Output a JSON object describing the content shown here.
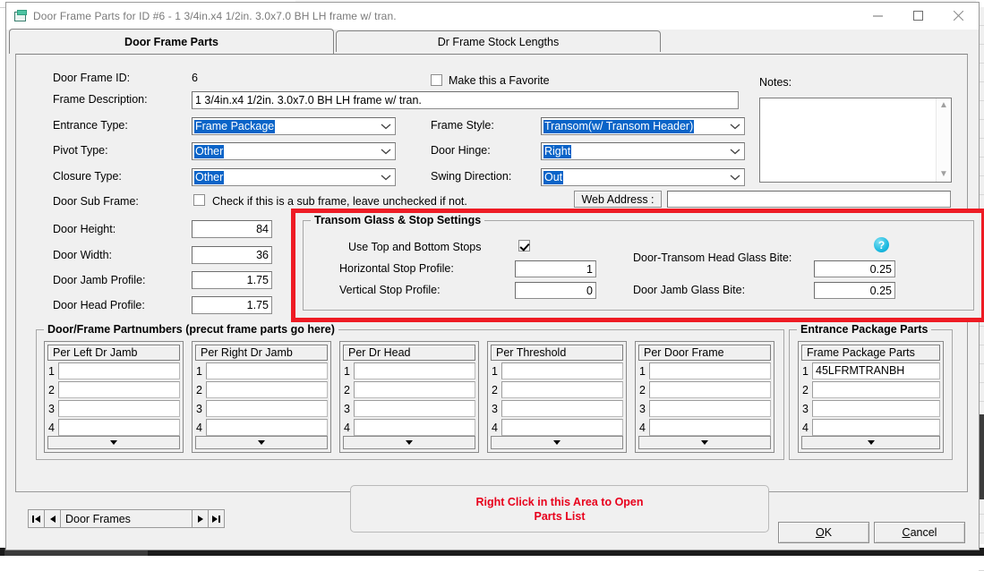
{
  "window": {
    "title": "Door Frame Parts for ID #6 - 1 3/4in.x4 1/2in. 3.0x7.0 BH LH frame w/ tran.",
    "icon": "window-app-icon",
    "minimize_label": "Minimize",
    "maximize_label": "Maximize",
    "close_label": "Close"
  },
  "tabs": [
    {
      "label": "Door Frame Parts",
      "active": true
    },
    {
      "label": "Dr Frame Stock Lengths",
      "active": false
    }
  ],
  "form": {
    "door_frame_id_label": "Door Frame ID:",
    "door_frame_id_value": "6",
    "frame_description_label": "Frame Description:",
    "frame_description_value": "1 3/4in.x4 1/2in. 3.0x7.0 BH LH frame w/ tran.",
    "entrance_type_label": "Entrance Type:",
    "entrance_type_value": "Frame Package",
    "pivot_type_label": "Pivot Type:",
    "pivot_type_value": "Other",
    "closure_type_label": "Closure Type:",
    "closure_type_value": "Other",
    "door_sub_frame_label": "Door Sub Frame:",
    "door_sub_frame_checkbox_text": "Check if this is a sub frame, leave unchecked if not.",
    "door_sub_frame_checked": false,
    "door_height_label": "Door Height:",
    "door_height_value": "84",
    "door_width_label": "Door Width:",
    "door_width_value": "36",
    "door_jamb_profile_label": "Door Jamb Profile:",
    "door_jamb_profile_value": "1.75",
    "door_head_profile_label": "Door Head Profile:",
    "door_head_profile_value": "1.75",
    "make_favorite_label": "Make this a Favorite",
    "make_favorite_checked": false,
    "frame_style_label": "Frame Style:",
    "frame_style_value": "Transom(w/ Transom Header)",
    "door_hinge_label": "Door Hinge:",
    "door_hinge_value": "Right",
    "swing_direction_label": "Swing Direction:",
    "swing_direction_value": "Out",
    "web_address_label": "Web Address :",
    "web_address_value": "",
    "notes_label": "Notes:",
    "notes_value": ""
  },
  "transom_group": {
    "title": "Transom Glass & Stop Settings",
    "use_top_bottom_stops_label": "Use Top and Bottom Stops",
    "use_top_bottom_stops_checked": true,
    "horizontal_stop_profile_label": "Horizontal Stop Profile:",
    "horizontal_stop_profile_value": "1",
    "vertical_stop_profile_label": "Vertical Stop Profile:",
    "vertical_stop_profile_value": "0",
    "door_transom_head_glass_bite_label": "Door-Transom Head Glass Bite:",
    "door_transom_head_glass_bite_value": "0.25",
    "door_jamb_glass_bite_label": "Door Jamb Glass Bite:",
    "door_jamb_glass_bite_value": "0.25",
    "help_icon": "question-mark-icon",
    "highlight_color": "#ee1b24"
  },
  "partnumbers_group": {
    "title": "Door/Frame Partnumbers (precut frame parts go here)",
    "lists": [
      {
        "header": "Per Left Dr Jamb",
        "rows": [
          "1",
          "2",
          "3",
          "4"
        ],
        "values": [
          "",
          "",
          "",
          ""
        ]
      },
      {
        "header": "Per Right Dr Jamb",
        "rows": [
          "1",
          "2",
          "3",
          "4"
        ],
        "values": [
          "",
          "",
          "",
          ""
        ]
      },
      {
        "header": "Per Dr Head",
        "rows": [
          "1",
          "2",
          "3",
          "4"
        ],
        "values": [
          "",
          "",
          "",
          ""
        ]
      },
      {
        "header": "Per Threshold",
        "rows": [
          "1",
          "2",
          "3",
          "4"
        ],
        "values": [
          "",
          "",
          "",
          ""
        ]
      },
      {
        "header": "Per Door Frame",
        "rows": [
          "1",
          "2",
          "3",
          "4"
        ],
        "values": [
          "",
          "",
          "",
          ""
        ]
      }
    ]
  },
  "entrance_package_group": {
    "title": "Entrance Package Parts",
    "lists": [
      {
        "header": "Frame Package Parts",
        "rows": [
          "1",
          "2",
          "3",
          "4"
        ],
        "values": [
          "45LFRMTRANBH",
          "",
          "",
          ""
        ]
      }
    ]
  },
  "navigator": {
    "first_label": "First record",
    "prev_label": "Previous record",
    "text": "Door Frames",
    "next_label": "Next record",
    "last_label": "Last record"
  },
  "right_click_area": {
    "line1": "Right Click in this Area to Open",
    "line2": "Parts List",
    "color": "#e8001c"
  },
  "buttons": {
    "ok": "OK",
    "ok_accel": "O",
    "cancel": "Cancel",
    "cancel_accel": "C"
  },
  "colors": {
    "dialog_bg": "#f0f0f0",
    "selection_blue": "#0a64c8",
    "highlight_red": "#ee1b24",
    "help_cyan": "#17b4dd"
  }
}
